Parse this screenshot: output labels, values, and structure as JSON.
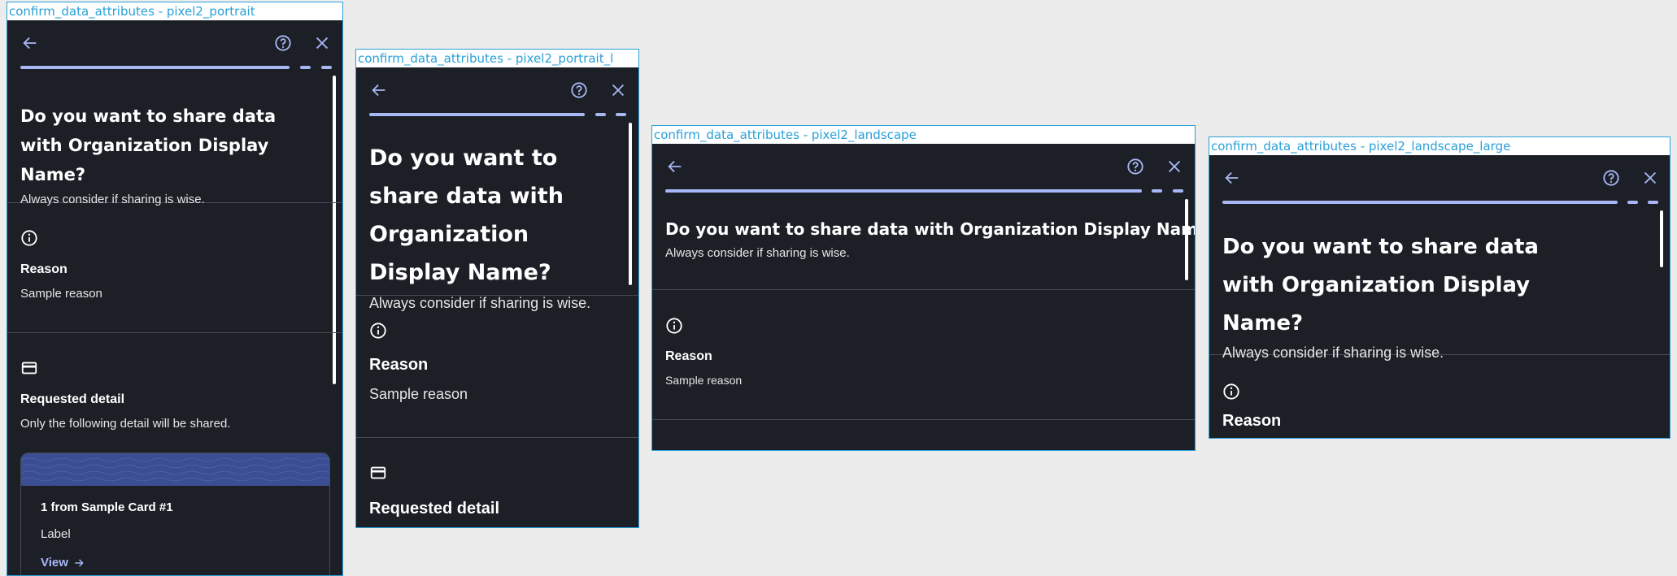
{
  "frames": [
    {
      "label": "confirm_data_attributes - pixel2_portrait",
      "title": "Do you want to share data with Organization Display Name?",
      "subtitle": "Always consider if sharing is wise.",
      "reason_heading": "Reason",
      "reason_text": "Sample reason",
      "requested_heading": "Requested detail",
      "requested_text": "Only the following detail will be shared.",
      "card_title": "1 from Sample Card #1",
      "card_label": "Label",
      "view_label": "View"
    },
    {
      "label": "confirm_data_attributes - pixel2_portrait_l",
      "title": "Do you want to share data with Organization Display Name?",
      "subtitle": "Always consider if sharing is wise.",
      "reason_heading": "Reason",
      "reason_text": "Sample reason",
      "requested_heading": "Requested detail"
    },
    {
      "label": "confirm_data_attributes - pixel2_landscape",
      "title": "Do you want to share data with Organization Display Name?",
      "subtitle": "Always consider if sharing is wise.",
      "reason_heading": "Reason",
      "reason_text": "Sample reason"
    },
    {
      "label": "confirm_data_attributes - pixel2_landscape_large",
      "title": "Do you want to share data with Organization Display Name?",
      "subtitle": "Always consider if sharing is wise.",
      "reason_heading": "Reason"
    }
  ],
  "icons": {
    "back": "arrow-left-icon",
    "help": "help-circle-icon",
    "close": "close-icon",
    "info": "info-icon",
    "card": "credit-card-icon",
    "arrow": "arrow-right-icon"
  },
  "colors": {
    "background": "#1c1f26",
    "accent": "#a7b7f5",
    "divider": "#454a55",
    "frame_border": "#29a0d8"
  }
}
